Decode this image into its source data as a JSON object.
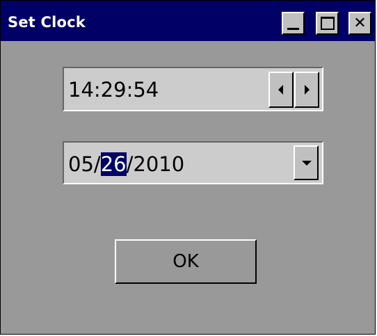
{
  "window": {
    "title": "Set Clock",
    "controls": {
      "minimize_icon": "minimize-icon",
      "maximize_icon": "maximize-icon",
      "close_glyph": "✕"
    }
  },
  "time_field": {
    "value": "14:29:54",
    "decrement_icon": "left-arrow-icon",
    "increment_icon": "right-arrow-icon"
  },
  "date_field": {
    "month": "05",
    "sep1": "/",
    "day_selected": "26",
    "sep2": "/",
    "year": "2010",
    "dropdown_icon": "chevron-down-icon"
  },
  "ok_button": {
    "label": "OK"
  },
  "colors": {
    "title_bar": "#000066",
    "window_bg": "#999999",
    "field_bg": "#cccccc",
    "selection_bg": "#000066",
    "selection_fg": "#ffffff"
  }
}
